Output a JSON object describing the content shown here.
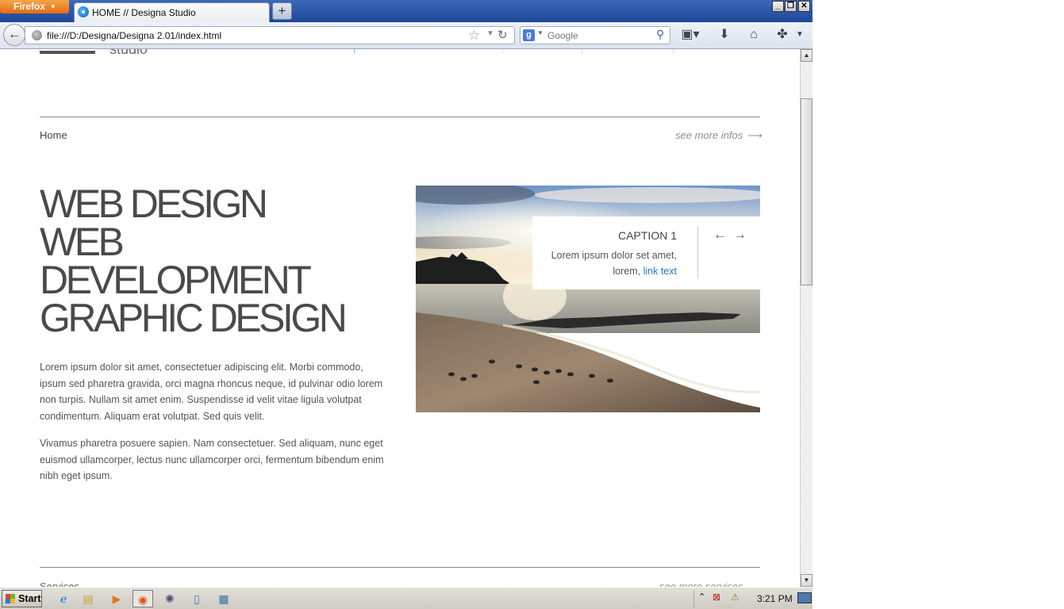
{
  "browser": {
    "menu_label": "Firefox",
    "tab_title": "HOME // Designa Studio",
    "new_tab_label": "+",
    "url": "file:///D:/Designa/Designa 2.01/index.html",
    "search_placeholder": "Google",
    "window_buttons": [
      "_",
      "❐",
      "✕"
    ]
  },
  "page": {
    "logo_text": "studio",
    "breadcrumb": "Home",
    "more_infos": "see more infos",
    "headline": [
      "WEB DESIGN",
      "WEB",
      "DEVELOPMENT",
      "GRAPHIC DESIGN"
    ],
    "paragraph1": "Lorem ipsum dolor sit amet, consectetuer adipiscing elit. Morbi commodo, ipsum sed pharetra gravida, orci magna rhoncus neque, id pulvinar odio lorem non turpis. Nullam sit amet enim. Suspendisse id velit vitae ligula volutpat condimentum. Aliquam erat volutpat. Sed quis velit.",
    "paragraph2": "Vivamus pharetra posuere sapien. Nam consectetuer. Sed aliquam, nunc eget euismod ullamcorper, lectus nunc ullamcorper orci, fermentum bibendum enim nibh eget ipsum.",
    "slider": {
      "caption_title": "CAPTION 1",
      "caption_text": "Lorem ipsum dolor set amet, lorem,",
      "caption_link": "link text",
      "prev": "←",
      "next": "→"
    },
    "services": "Services",
    "more_services": "see more services"
  },
  "taskbar": {
    "start_label": "Start",
    "clock": "3:21 PM"
  },
  "colors": {
    "link": "#2b7bb9",
    "headline": "#4a4a4a",
    "firefox_orange": "#e66b10",
    "titlebar_blue": "#2a54a6"
  }
}
